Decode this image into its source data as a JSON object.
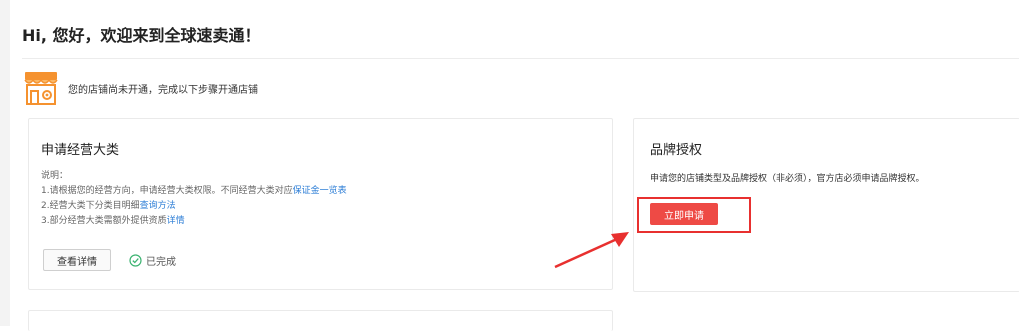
{
  "welcome": "Hi, 您好，欢迎来到全球速卖通！",
  "notice": "您的店铺尚未开通，完成以下步骤开通店铺",
  "category_card": {
    "title": "申请经营大类",
    "desc_label": "说明：",
    "line1_text": "1.请根据您的经营方向，申请经营大类权限。不同经营大类对应",
    "line1_link": "保证金一览表",
    "line2_text": "2.经营大类下分类目明细",
    "line2_link": "查询方法",
    "line3_text": "3.部分经营大类需额外提供资质",
    "line3_link": "详情",
    "detail_button": "查看详情",
    "status": "已完成"
  },
  "brand_card": {
    "title": "品牌授权",
    "desc": "申请您的店铺类型及品牌授权（非必须），官方店必须申请品牌授权。",
    "apply_button": "立即申请"
  },
  "colors": {
    "accent_red": "#ee4a45",
    "highlight_red": "#e8302f",
    "link_blue": "#2d7ed6",
    "done_green": "#3cb371",
    "shop_orange": "#f5922f"
  },
  "icons": {
    "shop": "shop-icon",
    "done": "check-circle-icon",
    "pointer": "red-arrow-annotation"
  }
}
